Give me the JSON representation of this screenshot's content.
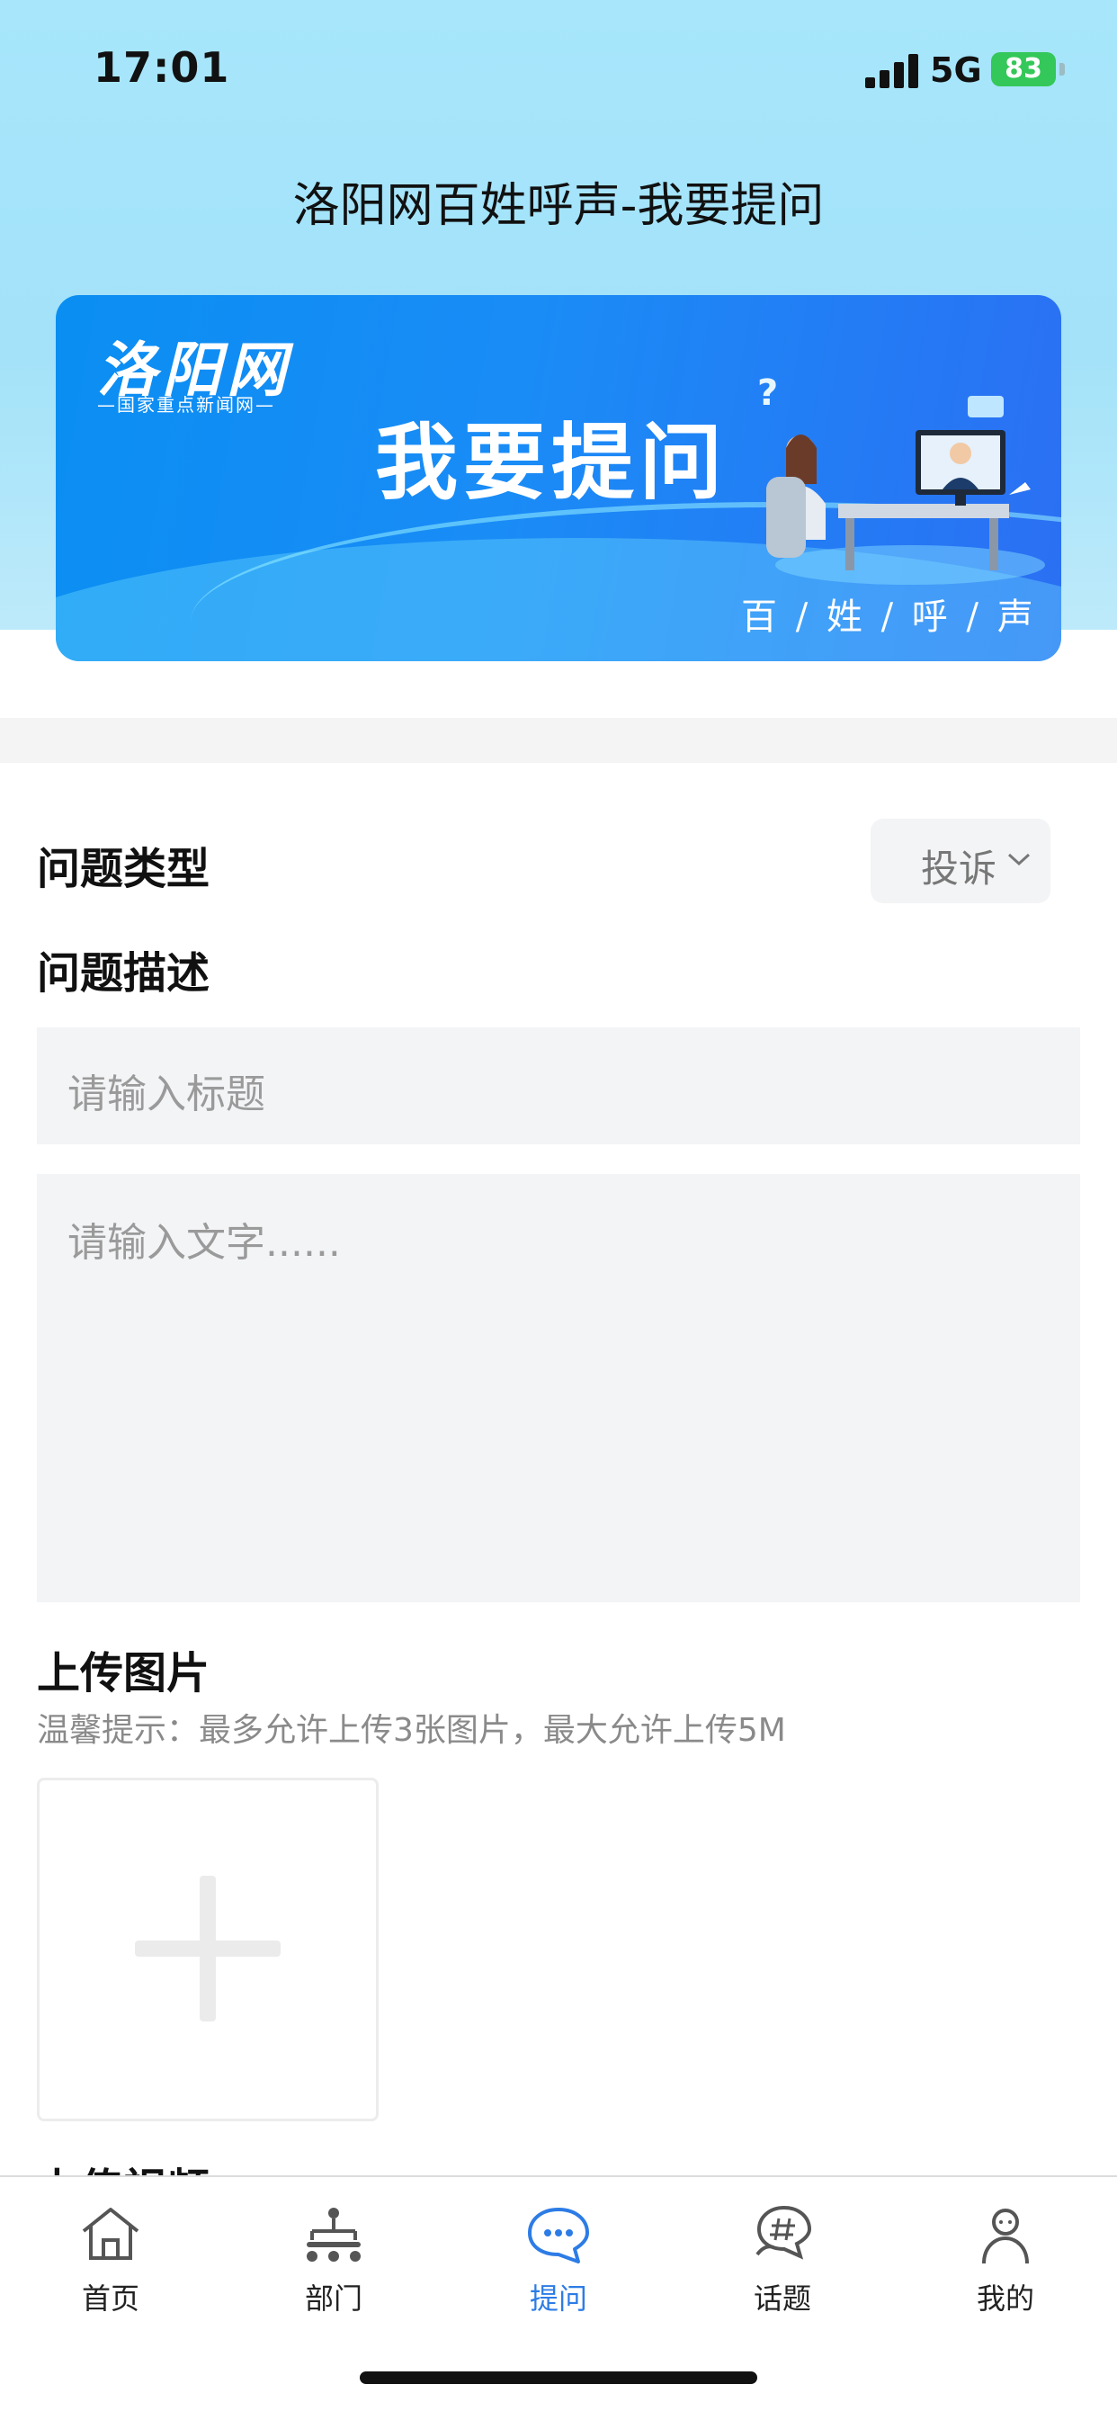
{
  "status_bar": {
    "time": "17:01",
    "network": "5G",
    "battery": "83"
  },
  "header": {
    "title": "洛阳网百姓呼声-我要提问"
  },
  "banner": {
    "logo": "洛阳网",
    "logo_subtitle": "—国家重点新闻网—",
    "headline": "我要提问",
    "slogan": "百 / 姓 / 呼 / 声"
  },
  "form": {
    "type_label": "问题类型",
    "type_value": "投诉",
    "description_label": "问题描述",
    "title_placeholder": "请输入标题",
    "text_placeholder": "请输入文字......",
    "upload_image_label": "上传图片",
    "upload_hint": "温馨提示：最多允许上传3张图片，最大允许上传5M",
    "upload_video_label": "上传视频"
  },
  "tabbar": {
    "active": "提问",
    "items": [
      {
        "label": "首页",
        "icon": "home-icon"
      },
      {
        "label": "部门",
        "icon": "org-chart-icon"
      },
      {
        "label": "提问",
        "icon": "chat-bubble-icon"
      },
      {
        "label": "话题",
        "icon": "topic-hashtag-icon"
      },
      {
        "label": "我的",
        "icon": "person-icon"
      }
    ]
  },
  "colors": {
    "accent": "#2d7ce6",
    "header_bg": "#a7e6fb",
    "battery": "#34c759",
    "input_bg": "#f3f4f6"
  }
}
